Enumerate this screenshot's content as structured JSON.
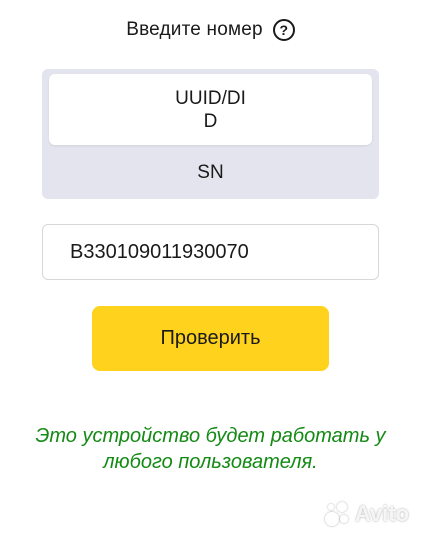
{
  "header": {
    "title": "Введите номер",
    "help_icon": "question-circle-icon",
    "help_glyph": "?"
  },
  "id_type_selector": {
    "options": [
      {
        "label": "UUID/DI\nD",
        "selected": true
      },
      {
        "label": "SN",
        "selected": false
      }
    ]
  },
  "serial_field": {
    "value": "B330109011930070"
  },
  "check_button": {
    "label": "Проверить"
  },
  "result": {
    "message": "Это устройство будет работать у любого пользователя."
  },
  "watermark": {
    "text": "Avito"
  },
  "colors": {
    "accent_button": "#ffd21e",
    "selector_bg": "#e3e4ee",
    "success_text": "#138a13"
  }
}
